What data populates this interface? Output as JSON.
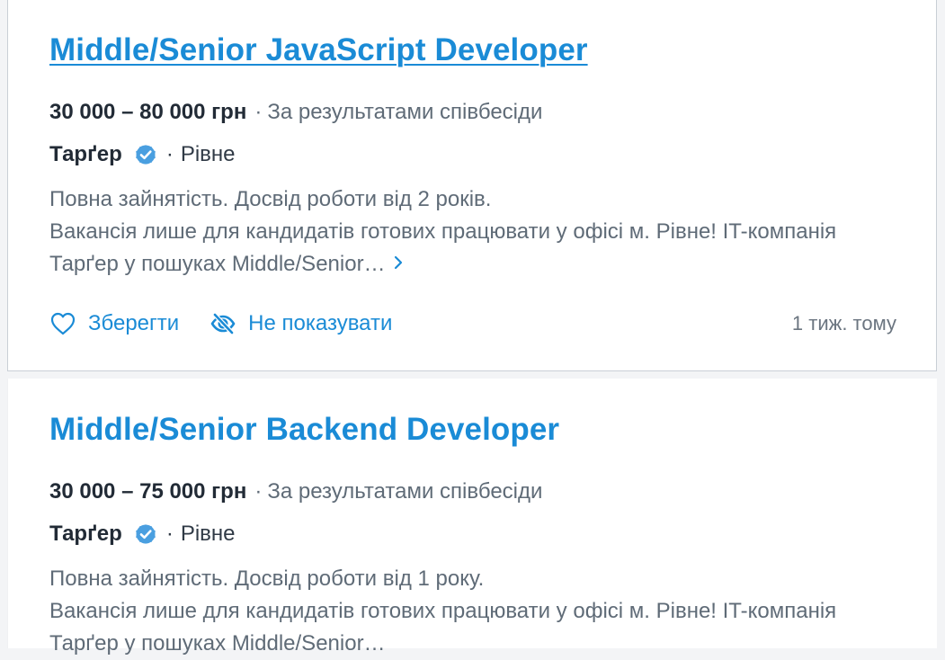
{
  "vacancies": [
    {
      "title": "Middle/Senior JavaScript Developer",
      "salary": "30 000 – 80 000 грн",
      "salary_note": "За результатами співбесіди",
      "company": "Тарґер",
      "city": "Рівне",
      "description_line1": "Повна зайнятість. Досвід роботи від 2 років.",
      "description_line2": "Вакансія лише для кандидатів готових працювати у офісі м. Рівне! IT-компанія",
      "description_line3": "Тарґер у пошуках Middle/Senior…",
      "save_label": "Зберегти",
      "hide_label": "Не показувати",
      "posted": "1 тиж. тому"
    },
    {
      "title": "Middle/Senior Backend Developer",
      "salary": "30 000 – 75 000 грн",
      "salary_note": "За результатами співбесіди",
      "company": "Тарґер",
      "city": "Рівне",
      "description_line1": "Повна зайнятість. Досвід роботи від 1 року.",
      "description_line2": "Вакансія лише для кандидатів готових працювати у офісі м. Рівне! IT-компанія",
      "description_line3": "Тарґер у пошуках Middle/Senior…"
    }
  ],
  "separator": "·",
  "icons": {
    "verified": "verified-badge-icon",
    "more": "chevron-right-icon",
    "save": "heart-icon",
    "hide": "eye-off-icon"
  },
  "colors": {
    "link": "#1a8bd6",
    "verified": "#4a9fe0",
    "text_dark": "#222b36",
    "text_muted": "#5f6b77"
  }
}
